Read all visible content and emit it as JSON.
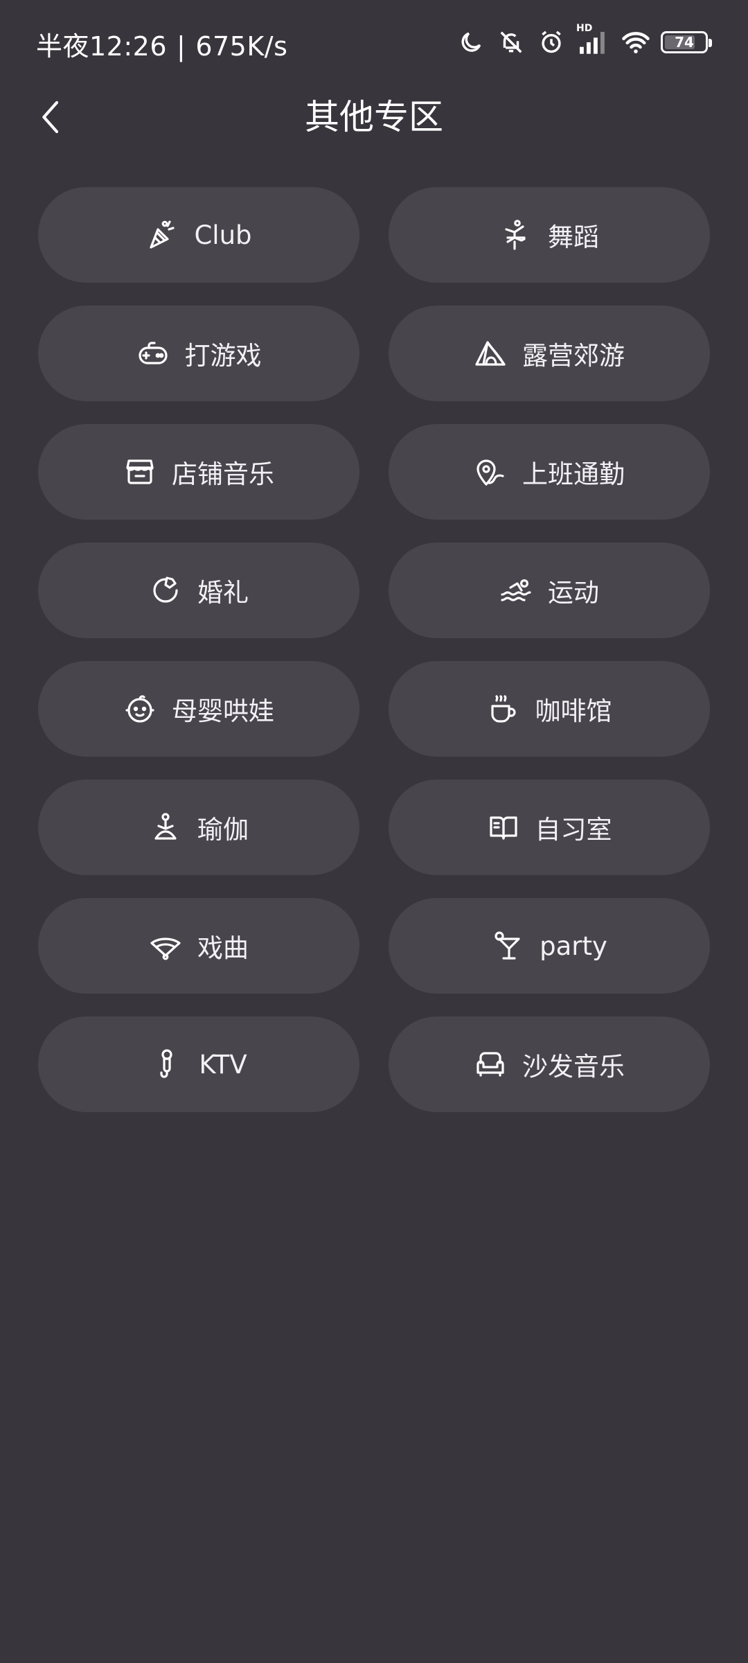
{
  "status_bar": {
    "time": "半夜12:26",
    "network_speed": "675K/s",
    "battery": "74",
    "signal_badge": "HD",
    "icons": [
      "moon-icon",
      "bell-off-icon",
      "alarm-icon",
      "signal-icon",
      "wifi-icon",
      "battery-icon"
    ]
  },
  "header": {
    "title": "其他专区"
  },
  "categories": [
    {
      "label": "Club",
      "icon": "party-popper-icon"
    },
    {
      "label": "舞蹈",
      "icon": "dancer-icon"
    },
    {
      "label": "打游戏",
      "icon": "gamepad-icon"
    },
    {
      "label": "露营郊游",
      "icon": "tent-icon"
    },
    {
      "label": "店铺音乐",
      "icon": "store-icon"
    },
    {
      "label": "上班通勤",
      "icon": "location-route-icon"
    },
    {
      "label": "婚礼",
      "icon": "ring-icon"
    },
    {
      "label": "运动",
      "icon": "swimming-icon"
    },
    {
      "label": "母婴哄娃",
      "icon": "baby-face-icon"
    },
    {
      "label": "咖啡馆",
      "icon": "coffee-cup-icon"
    },
    {
      "label": "瑜伽",
      "icon": "yoga-icon"
    },
    {
      "label": "自习室",
      "icon": "open-book-icon"
    },
    {
      "label": "戏曲",
      "icon": "fan-icon"
    },
    {
      "label": "party",
      "icon": "cocktail-icon"
    },
    {
      "label": "KTV",
      "icon": "microphone-icon"
    },
    {
      "label": "沙发音乐",
      "icon": "sofa-icon"
    }
  ]
}
